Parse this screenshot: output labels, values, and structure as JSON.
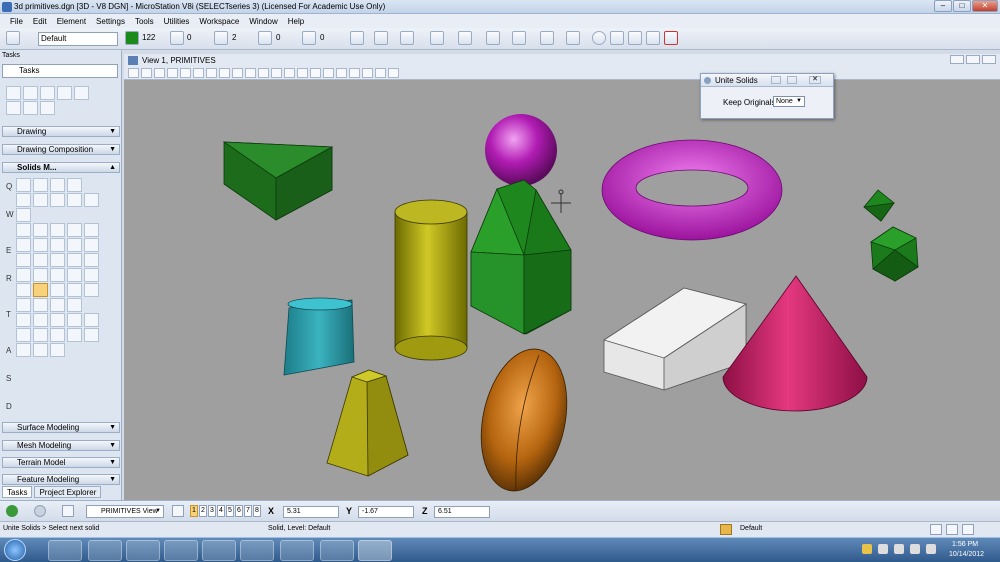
{
  "window": {
    "title": "3d primitives.dgn [3D - V8 DGN] - MicroStation V8i (SELECTseries 3) (Licensed For Academic Use Only)",
    "min": "–",
    "max": "□",
    "close": "✕"
  },
  "menu": [
    "File",
    "Edit",
    "Element",
    "Settings",
    "Tools",
    "Utilities",
    "Workspace",
    "Window",
    "Help"
  ],
  "toolbar": {
    "level": "Default",
    "color": "122",
    "style": "0",
    "weight": "2",
    "transparency": "0",
    "priority": "0"
  },
  "tasks": {
    "title": "Tasks",
    "dropdown": "Tasks",
    "sections": [
      "Drawing",
      "Drawing Composition"
    ],
    "solids_label": "Solids M...",
    "row_letters": [
      "Q",
      "W",
      "E",
      "R",
      "T",
      "A",
      "S",
      "D"
    ],
    "bottom_sections": [
      "Surface Modeling",
      "Mesh Modeling",
      "Terrain Model",
      "Feature Modeling"
    ],
    "tabs": [
      "Tasks",
      "Project Explorer"
    ]
  },
  "view": {
    "title": "View 1, PRIMITIVES"
  },
  "dialog": {
    "title": "Unite Solids",
    "label": "Keep Originals:",
    "value": "None"
  },
  "status": {
    "view_select": "PRIMITIVES View",
    "view_numbers": [
      "1",
      "2",
      "3",
      "4",
      "5",
      "6",
      "7",
      "8"
    ],
    "x_label": "X",
    "x_value": "5.31",
    "y_label": "Y",
    "y_value": "-1.67",
    "z_label": "Z",
    "z_value": "6.51",
    "prompt": "Unite Solids > Select next solid",
    "message": "Solid, Level: Default",
    "level": "Default"
  },
  "taskbar": {
    "time": "1:56 PM",
    "date": "10/14/2012"
  }
}
